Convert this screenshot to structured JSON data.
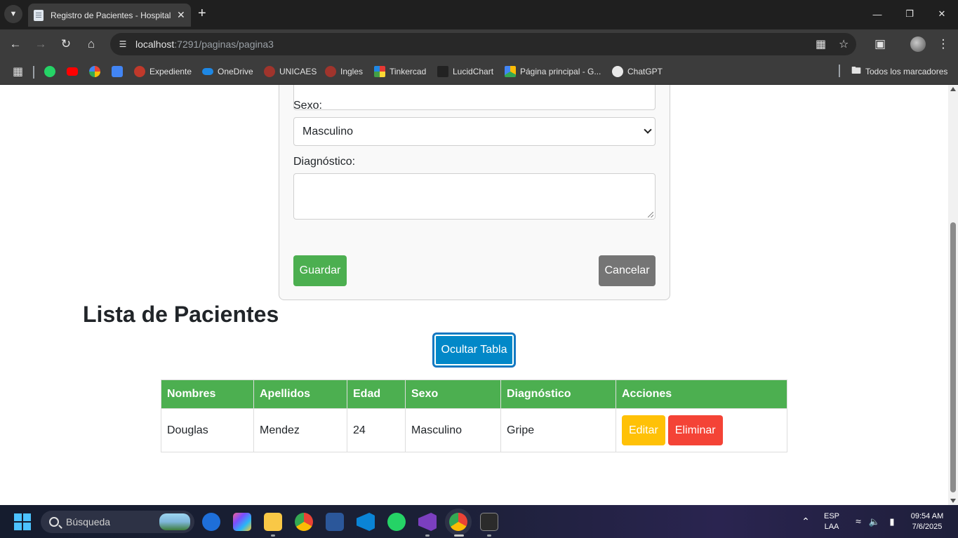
{
  "browser": {
    "tab_title": "Registro de Pacientes - Hospital",
    "url_host": "localhost",
    "url_rest": ":7291/paginas/pagina3",
    "bookmarks": [
      "Expediente",
      "OneDrive",
      "UNICAES",
      "Ingles",
      "Tinkercad",
      "LucidChart",
      "Página principal - G...",
      "ChatGPT"
    ],
    "all_bookmarks": "Todos los marcadores"
  },
  "form": {
    "sexo_label": "Sexo:",
    "sexo_value": "Masculino",
    "diagnostico_label": "Diagnóstico:",
    "save_label": "Guardar",
    "cancel_label": "Cancelar"
  },
  "list": {
    "title": "Lista de Pacientes",
    "toggle_label": "Ocultar Tabla",
    "headers": [
      "Nombres",
      "Apellidos",
      "Edad",
      "Sexo",
      "Diagnóstico",
      "Acciones"
    ],
    "rows": [
      {
        "nombres": "Douglas",
        "apellidos": "Mendez",
        "edad": "24",
        "sexo": "Masculino",
        "diagnostico": "Gripe"
      }
    ],
    "edit_label": "Editar",
    "delete_label": "Eliminar"
  },
  "taskbar": {
    "search_placeholder": "Búsqueda",
    "lang_top": "ESP",
    "lang_bottom": "LAA",
    "time": "09:54 AM",
    "date": "7/6/2025"
  },
  "colors": {
    "primary_green": "#4caf50",
    "toggle_blue": "#0288c8",
    "edit_yellow": "#ffc107",
    "delete_red": "#f44336",
    "cancel_gray": "#757575"
  }
}
